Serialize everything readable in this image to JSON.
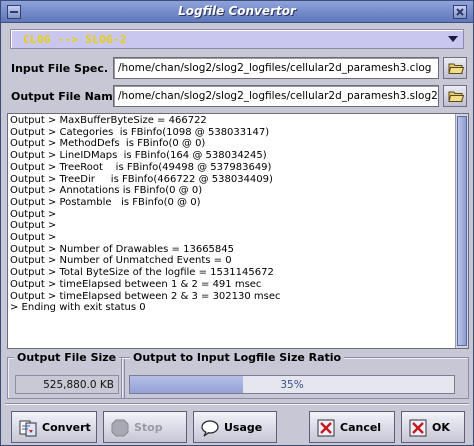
{
  "window": {
    "title": "Logfile Convertor"
  },
  "converter": {
    "selected": "CLOG   --> SLOG-2"
  },
  "input": {
    "label": "Input File Spec. :",
    "value": "/home/chan/slog2/slog2_logfiles/cellular2d_paramesh3.clog"
  },
  "output": {
    "label": "Output File Name :",
    "value": "/home/chan/slog2/slog2_logfiles/cellular2d_paramesh3.slog2"
  },
  "console": {
    "lines": [
      "Output > MaxBufferByteSize = 466722",
      "Output > Categories  is FBinfo(1098 @ 538033147)",
      "Output > MethodDefs  is FBinfo(0 @ 0)",
      "Output > LineIDMaps  is FBinfo(164 @ 538034245)",
      "Output > TreeRoot    is FBinfo(49498 @ 537983649)",
      "Output > TreeDir     is FBinfo(466722 @ 538034409)",
      "Output > Annotations is FBinfo(0 @ 0)",
      "Output > Postamble   is FBinfo(0 @ 0)",
      "Output >",
      "Output >",
      "Output >",
      "Output > Number of Drawables = 13665845",
      "Output > Number of Unmatched Events = 0",
      "Output > Total ByteSize of the logfile = 1531145672",
      "Output > timeElapsed between 1 & 2 = 491 msec",
      "Output > timeElapsed between 2 & 3 = 302130 msec",
      "> Ending with exit status 0"
    ]
  },
  "output_size": {
    "label": "Output File Size",
    "value": "525,880.0 KB"
  },
  "ratio": {
    "label": "Output to Input Logfile Size Ratio",
    "text": "35%",
    "fraction": 0.35
  },
  "buttons": {
    "convert": "Convert",
    "stop": "Stop",
    "usage": "Usage",
    "cancel": "Cancel",
    "ok": "OK"
  },
  "icons": {
    "titlebar_left": "window-menu-icon",
    "titlebar_right": "close-icon",
    "input_browse": "folder-open-icon",
    "output_browse": "folder-open-icon",
    "convert": "convert-icon",
    "stop": "stop-icon",
    "usage": "speech-bubble-icon",
    "cancel": "cancel-x-icon",
    "ok": "ok-x-icon"
  }
}
